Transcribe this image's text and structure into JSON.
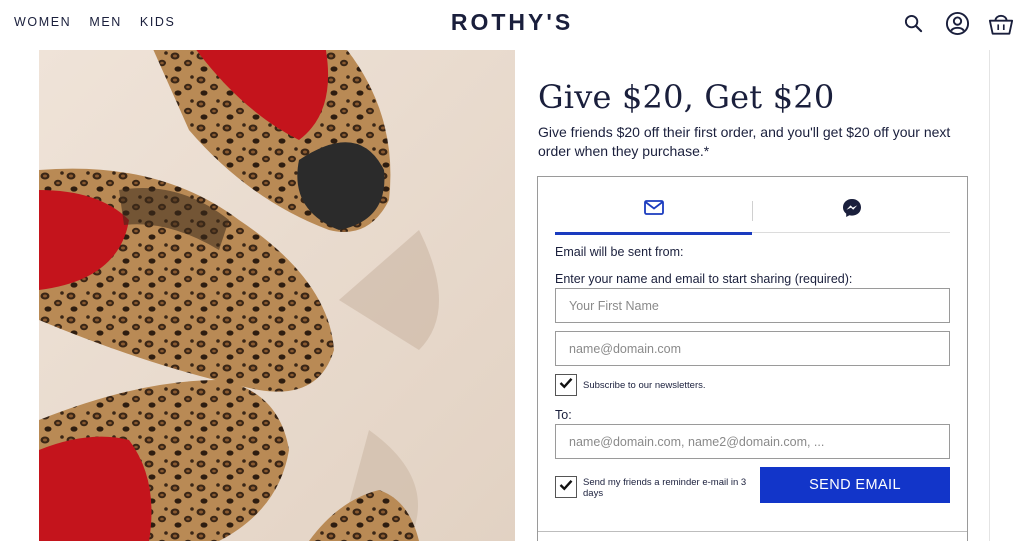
{
  "header": {
    "nav": [
      "WOMEN",
      "MEN",
      "KIDS"
    ],
    "brand": "ROTHY'S",
    "icons": [
      "search-icon",
      "account-icon",
      "basket-icon"
    ]
  },
  "hero": {
    "subject": "leopard-print-shoes-image"
  },
  "referral": {
    "title": "Give $20, Get $20",
    "subtitle": "Give friends $20 off their first order, and you'll get $20 off your next order when they purchase.*",
    "tabs": [
      {
        "id": "email",
        "icon": "envelope-icon",
        "active": true
      },
      {
        "id": "messenger",
        "icon": "messenger-icon",
        "active": false
      }
    ],
    "from_label": "Email will be sent from:",
    "enter_label": "Enter your name and email to start sharing (required):",
    "first_name_placeholder": "Your First Name",
    "email_placeholder": "name@domain.com",
    "subscribe_label": "Subscribe to our newsletters.",
    "subscribe_checked": true,
    "to_label": "To:",
    "to_placeholder": "name@domain.com, name2@domain.com, ...",
    "reminder_label": "Send my friends a reminder e-mail in 3 days",
    "reminder_checked": true,
    "send_label": "SEND EMAIL"
  },
  "colors": {
    "text": "#1a1f3c",
    "accent": "#1235c9",
    "tab_active": "#1a3bbf"
  }
}
